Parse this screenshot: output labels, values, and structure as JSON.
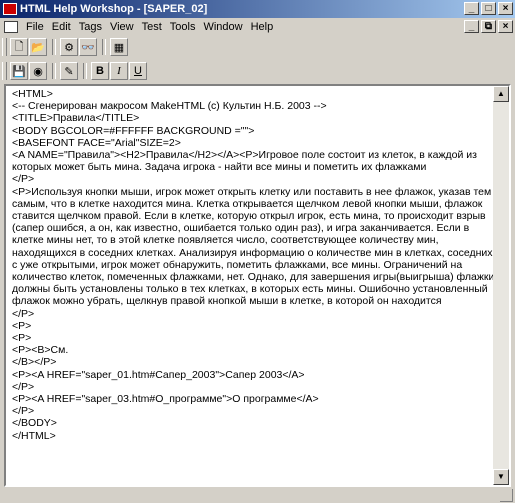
{
  "window": {
    "title": "HTML Help Workshop - [SAPER_02]"
  },
  "menu": [
    "File",
    "Edit",
    "Tags",
    "View",
    "Test",
    "Tools",
    "Window",
    "Help"
  ],
  "toolbar1": [
    {
      "name": "new-icon",
      "glyph": "🗋"
    },
    {
      "name": "open-icon",
      "glyph": "📂"
    },
    {
      "name": "compile-icon",
      "glyph": "⚙"
    },
    {
      "name": "view-compiled-icon",
      "glyph": "👓"
    },
    {
      "name": "display-topic-icon",
      "glyph": "▦"
    }
  ],
  "toolbar2": [
    {
      "name": "save-icon",
      "glyph": "💾"
    },
    {
      "name": "view-in-browser-icon",
      "glyph": "◉"
    },
    {
      "name": "tag-icon",
      "glyph": "✎"
    },
    {
      "name": "bold-button",
      "glyph": "B"
    },
    {
      "name": "italic-button",
      "glyph": "I"
    },
    {
      "name": "underline-button",
      "glyph": "U"
    }
  ],
  "editor": {
    "content": "<HTML>\n<-- Сгенерирован макросом MakeHTML (c) Культин Н.Б. 2003 -->\n<TITLE>Правила</TITLE>\n<BODY BGCOLOR=#FFFFFF BACKGROUND =\"\">\n<BASEFONT FACE=\"Arial\"SIZE=2>\n<A NAME=\"Правила\"><H2>Правила</H2></A><P>Игровое поле состоит из клеток, в каждой из которых может быть мина. Задача игрока - найти все мины и пометить их флажками\n</P>\n<P>Используя кнопки мыши, игрок может открыть клетку или поставить в нее флажок, указав тем самым, что в клетке находится мина. Клетка открывается щелчком левой кнопки мыши, флажок ставится щелчком правой. Если в клетке, которую открыл игрок, есть мина, то происходит взрыв (сапер ошибся, а он, как известно, ошибается только один раз), и игра заканчивается. Если в клетке мины нет, то в этой клетке появляется число, соответствующее количеству мин, находящихся в соседних клетках. Анализируя информацию о количестве мин в клетках, соседних с уже открытыми, игрок может обнаружить, пометить флажками, все мины. Ограничений на количество клеток, помеченных флажками, нет. Однако, для завершения игры(выигрыша) флажки должны быть установлены только в тех клетках, в которых есть мины. Ошибочно установленный флажок можно убрать, щелкнув правой кнопкой мыши в клетке, в которой он находится\n</P>\n<P>\n<P>\n<P><B>См.\n</B></P>\n<P><A HREF=\"saper_01.htm#Сапер_2003\">Сапер 2003</A>\n</P>\n<P><A HREF=\"saper_03.htm#О_программе\">О программе</A>\n</P>\n</BODY>\n</HTML>"
  }
}
